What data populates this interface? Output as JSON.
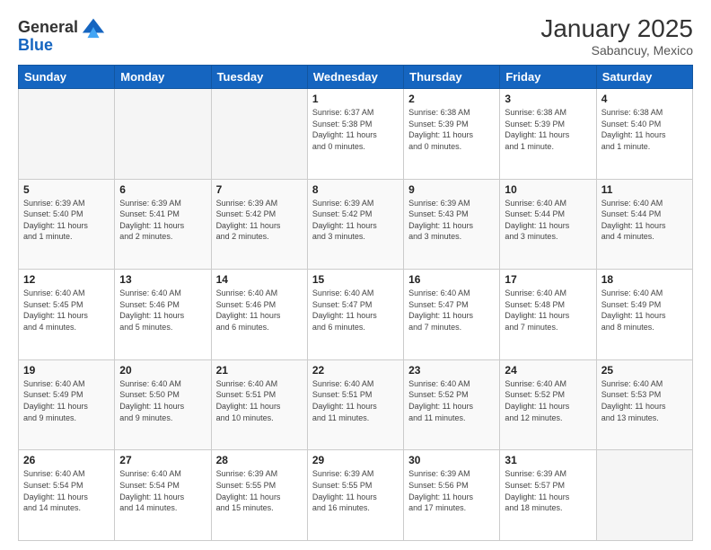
{
  "header": {
    "logo_general": "General",
    "logo_blue": "Blue",
    "month_year": "January 2025",
    "location": "Sabancuy, Mexico"
  },
  "days_of_week": [
    "Sunday",
    "Monday",
    "Tuesday",
    "Wednesday",
    "Thursday",
    "Friday",
    "Saturday"
  ],
  "weeks": [
    [
      {
        "day": "",
        "info": ""
      },
      {
        "day": "",
        "info": ""
      },
      {
        "day": "",
        "info": ""
      },
      {
        "day": "1",
        "info": "Sunrise: 6:37 AM\nSunset: 5:38 PM\nDaylight: 11 hours\nand 0 minutes."
      },
      {
        "day": "2",
        "info": "Sunrise: 6:38 AM\nSunset: 5:39 PM\nDaylight: 11 hours\nand 0 minutes."
      },
      {
        "day": "3",
        "info": "Sunrise: 6:38 AM\nSunset: 5:39 PM\nDaylight: 11 hours\nand 1 minute."
      },
      {
        "day": "4",
        "info": "Sunrise: 6:38 AM\nSunset: 5:40 PM\nDaylight: 11 hours\nand 1 minute."
      }
    ],
    [
      {
        "day": "5",
        "info": "Sunrise: 6:39 AM\nSunset: 5:40 PM\nDaylight: 11 hours\nand 1 minute."
      },
      {
        "day": "6",
        "info": "Sunrise: 6:39 AM\nSunset: 5:41 PM\nDaylight: 11 hours\nand 2 minutes."
      },
      {
        "day": "7",
        "info": "Sunrise: 6:39 AM\nSunset: 5:42 PM\nDaylight: 11 hours\nand 2 minutes."
      },
      {
        "day": "8",
        "info": "Sunrise: 6:39 AM\nSunset: 5:42 PM\nDaylight: 11 hours\nand 3 minutes."
      },
      {
        "day": "9",
        "info": "Sunrise: 6:39 AM\nSunset: 5:43 PM\nDaylight: 11 hours\nand 3 minutes."
      },
      {
        "day": "10",
        "info": "Sunrise: 6:40 AM\nSunset: 5:44 PM\nDaylight: 11 hours\nand 3 minutes."
      },
      {
        "day": "11",
        "info": "Sunrise: 6:40 AM\nSunset: 5:44 PM\nDaylight: 11 hours\nand 4 minutes."
      }
    ],
    [
      {
        "day": "12",
        "info": "Sunrise: 6:40 AM\nSunset: 5:45 PM\nDaylight: 11 hours\nand 4 minutes."
      },
      {
        "day": "13",
        "info": "Sunrise: 6:40 AM\nSunset: 5:46 PM\nDaylight: 11 hours\nand 5 minutes."
      },
      {
        "day": "14",
        "info": "Sunrise: 6:40 AM\nSunset: 5:46 PM\nDaylight: 11 hours\nand 6 minutes."
      },
      {
        "day": "15",
        "info": "Sunrise: 6:40 AM\nSunset: 5:47 PM\nDaylight: 11 hours\nand 6 minutes."
      },
      {
        "day": "16",
        "info": "Sunrise: 6:40 AM\nSunset: 5:47 PM\nDaylight: 11 hours\nand 7 minutes."
      },
      {
        "day": "17",
        "info": "Sunrise: 6:40 AM\nSunset: 5:48 PM\nDaylight: 11 hours\nand 7 minutes."
      },
      {
        "day": "18",
        "info": "Sunrise: 6:40 AM\nSunset: 5:49 PM\nDaylight: 11 hours\nand 8 minutes."
      }
    ],
    [
      {
        "day": "19",
        "info": "Sunrise: 6:40 AM\nSunset: 5:49 PM\nDaylight: 11 hours\nand 9 minutes."
      },
      {
        "day": "20",
        "info": "Sunrise: 6:40 AM\nSunset: 5:50 PM\nDaylight: 11 hours\nand 9 minutes."
      },
      {
        "day": "21",
        "info": "Sunrise: 6:40 AM\nSunset: 5:51 PM\nDaylight: 11 hours\nand 10 minutes."
      },
      {
        "day": "22",
        "info": "Sunrise: 6:40 AM\nSunset: 5:51 PM\nDaylight: 11 hours\nand 11 minutes."
      },
      {
        "day": "23",
        "info": "Sunrise: 6:40 AM\nSunset: 5:52 PM\nDaylight: 11 hours\nand 11 minutes."
      },
      {
        "day": "24",
        "info": "Sunrise: 6:40 AM\nSunset: 5:52 PM\nDaylight: 11 hours\nand 12 minutes."
      },
      {
        "day": "25",
        "info": "Sunrise: 6:40 AM\nSunset: 5:53 PM\nDaylight: 11 hours\nand 13 minutes."
      }
    ],
    [
      {
        "day": "26",
        "info": "Sunrise: 6:40 AM\nSunset: 5:54 PM\nDaylight: 11 hours\nand 14 minutes."
      },
      {
        "day": "27",
        "info": "Sunrise: 6:40 AM\nSunset: 5:54 PM\nDaylight: 11 hours\nand 14 minutes."
      },
      {
        "day": "28",
        "info": "Sunrise: 6:39 AM\nSunset: 5:55 PM\nDaylight: 11 hours\nand 15 minutes."
      },
      {
        "day": "29",
        "info": "Sunrise: 6:39 AM\nSunset: 5:55 PM\nDaylight: 11 hours\nand 16 minutes."
      },
      {
        "day": "30",
        "info": "Sunrise: 6:39 AM\nSunset: 5:56 PM\nDaylight: 11 hours\nand 17 minutes."
      },
      {
        "day": "31",
        "info": "Sunrise: 6:39 AM\nSunset: 5:57 PM\nDaylight: 11 hours\nand 18 minutes."
      },
      {
        "day": "",
        "info": ""
      }
    ]
  ]
}
